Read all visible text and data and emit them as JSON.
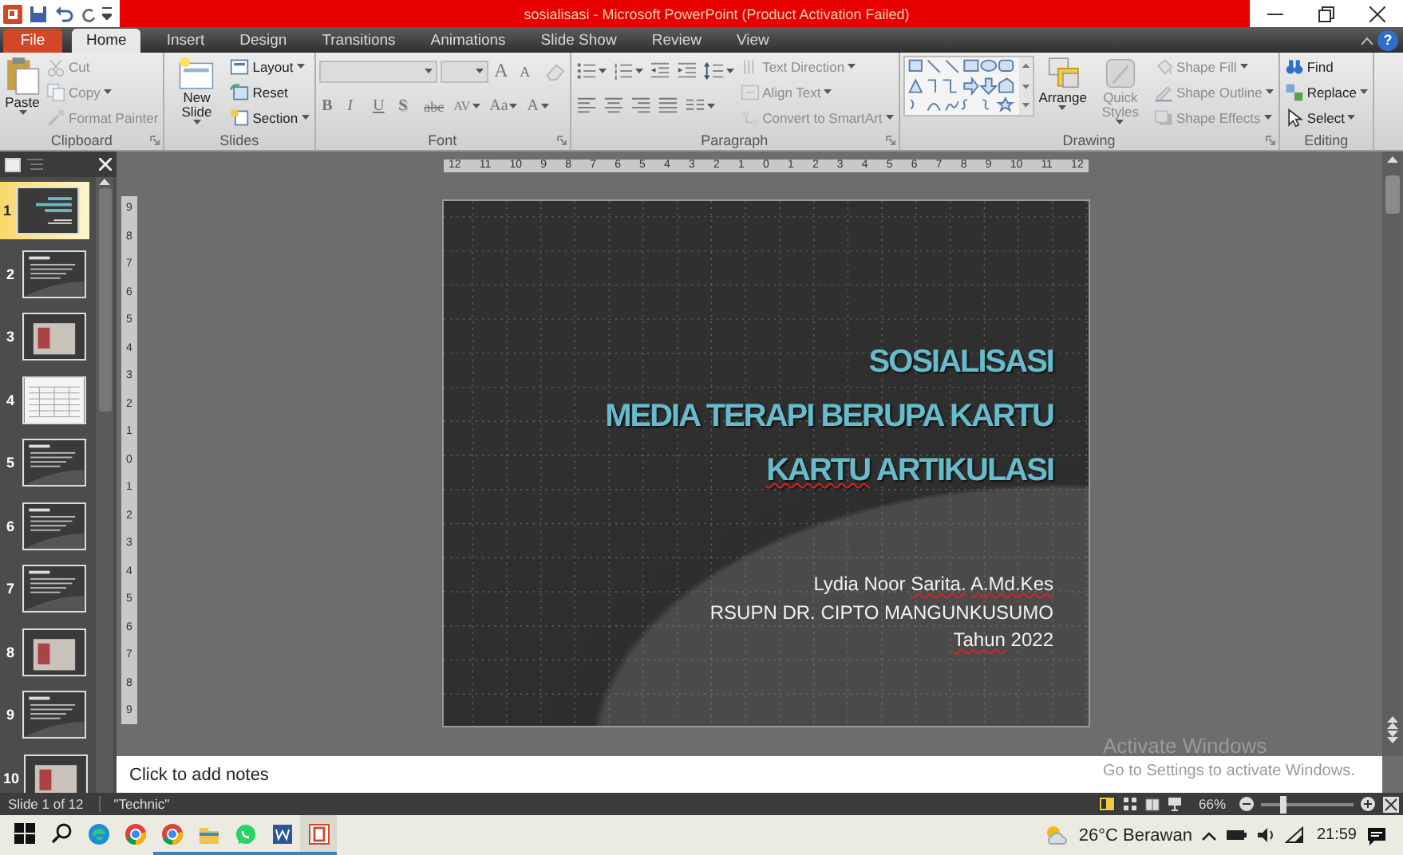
{
  "title_bar": {
    "title": "sosialisasi  -  Microsoft PowerPoint (Product Activation Failed)"
  },
  "ribbon_tabs": [
    {
      "label": "File",
      "kind": "file",
      "selected": false
    },
    {
      "label": "Home",
      "kind": "tab",
      "selected": true
    },
    {
      "label": "Insert",
      "kind": "tab",
      "selected": false
    },
    {
      "label": "Design",
      "kind": "tab",
      "selected": false
    },
    {
      "label": "Transitions",
      "kind": "tab",
      "selected": false
    },
    {
      "label": "Animations",
      "kind": "tab",
      "selected": false
    },
    {
      "label": "Slide Show",
      "kind": "tab",
      "selected": false
    },
    {
      "label": "Review",
      "kind": "tab",
      "selected": false
    },
    {
      "label": "View",
      "kind": "tab",
      "selected": false
    }
  ],
  "help_button": {
    "label": "?"
  },
  "ribbon_groups": [
    {
      "label": "Clipboard",
      "launcher": true,
      "columns": [
        {
          "kind": "large",
          "items": [
            {
              "label": "Paste",
              "dropdown": true,
              "disabled": false
            }
          ]
        },
        {
          "kind": "stack",
          "items": [
            {
              "label": "Cut",
              "dropdown": false,
              "disabled": true
            },
            {
              "label": "Copy",
              "dropdown": true,
              "disabled": true
            },
            {
              "label": "Format Painter",
              "dropdown": false,
              "disabled": true
            }
          ]
        }
      ]
    },
    {
      "label": "Slides",
      "launcher": false,
      "columns": [
        {
          "kind": "large",
          "items": [
            {
              "label": "New Slide",
              "dropdown": true,
              "disabled": false
            }
          ]
        },
        {
          "kind": "stack",
          "items": [
            {
              "label": "Layout",
              "dropdown": true,
              "disabled": false
            },
            {
              "label": "Reset",
              "dropdown": false,
              "disabled": false
            },
            {
              "label": "Section",
              "dropdown": true,
              "disabled": false
            }
          ]
        }
      ]
    },
    {
      "label": "Font",
      "launcher": true,
      "columns": [
        {
          "kind": "rows",
          "rows": [
            {
              "items": [
                {
                  "kind": "field",
                  "disabled": true
                },
                {
                  "kind": "field",
                  "disabled": true
                },
                {
                  "kind": "glyph",
                  "label": "A",
                  "dropdown": false,
                  "disabled": true
                },
                {
                  "kind": "glyph",
                  "label": "A",
                  "dropdown": false,
                  "disabled": true
                },
                {
                  "kind": "icon",
                  "dropdown": false,
                  "disabled": true
                }
              ]
            },
            {
              "items": [
                {
                  "kind": "glyph",
                  "label": "B",
                  "dropdown": false,
                  "disabled": true
                },
                {
                  "kind": "glyph",
                  "label": "I",
                  "dropdown": false,
                  "disabled": true
                },
                {
                  "kind": "glyph",
                  "label": "U",
                  "dropdown": false,
                  "disabled": true
                },
                {
                  "kind": "glyph",
                  "label": "S",
                  "dropdown": false,
                  "disabled": true
                },
                {
                  "kind": "glyph",
                  "label": "abc",
                  "dropdown": false,
                  "disabled": true
                },
                {
                  "kind": "glyph",
                  "label": "AV",
                  "dropdown": true,
                  "disabled": true
                },
                {
                  "kind": "glyph",
                  "label": "Aa",
                  "dropdown": true,
                  "disabled": true
                },
                {
                  "kind": "glyph",
                  "label": "A",
                  "dropdown": true,
                  "disabled": true
                }
              ]
            }
          ]
        }
      ]
    },
    {
      "label": "Paragraph",
      "launcher": true,
      "columns": [
        {
          "kind": "rows",
          "rows": [
            {
              "items": [
                {
                  "kind": "icon",
                  "dropdown": true,
                  "disabled": false
                },
                {
                  "kind": "icon",
                  "dropdown": true,
                  "disabled": false
                },
                {
                  "kind": "icon",
                  "dropdown": false,
                  "disabled": false
                },
                {
                  "kind": "icon",
                  "dropdown": false,
                  "disabled": false
                },
                {
                  "kind": "icon",
                  "dropdown": true,
                  "disabled": false
                }
              ]
            },
            {
              "items": [
                {
                  "kind": "icon",
                  "dropdown": false,
                  "disabled": false
                },
                {
                  "kind": "icon",
                  "dropdown": false,
                  "disabled": false
                },
                {
                  "kind": "icon",
                  "dropdown": false,
                  "disabled": false
                },
                {
                  "kind": "icon",
                  "dropdown": false,
                  "disabled": false
                },
                {
                  "kind": "icon",
                  "dropdown": true,
                  "disabled": false
                }
              ]
            }
          ]
        },
        {
          "kind": "stack",
          "items": [
            {
              "label": "Text Direction",
              "dropdown": true,
              "disabled": true
            },
            {
              "label": "Align Text",
              "dropdown": true,
              "disabled": true
            },
            {
              "label": "Convert to SmartArt",
              "dropdown": true,
              "disabled": true
            }
          ]
        }
      ]
    },
    {
      "label": "Drawing",
      "launcher": true,
      "columns": [
        {
          "kind": "gallery"
        },
        {
          "kind": "large",
          "items": [
            {
              "label": "Arrange",
              "dropdown": true,
              "disabled": false
            }
          ]
        },
        {
          "kind": "large",
          "items": [
            {
              "label": "Quick Styles",
              "dropdown": true,
              "disabled": true
            }
          ]
        },
        {
          "kind": "stack",
          "items": [
            {
              "label": "Shape Fill",
              "dropdown": true,
              "disabled": true
            },
            {
              "label": "Shape Outline",
              "dropdown": true,
              "disabled": true
            },
            {
              "label": "Shape Effects",
              "dropdown": true,
              "disabled": true
            }
          ]
        }
      ]
    },
    {
      "label": "Editing",
      "launcher": false,
      "columns": [
        {
          "kind": "stack",
          "items": [
            {
              "label": "Find",
              "dropdown": false,
              "disabled": false
            },
            {
              "label": "Replace",
              "dropdown": true,
              "disabled": false
            },
            {
              "label": "Select",
              "dropdown": true,
              "disabled": false
            }
          ]
        }
      ]
    }
  ],
  "slide_panel": {
    "thumbnails": [
      {
        "number": "1",
        "kind": "title",
        "selected": true
      },
      {
        "number": "2",
        "kind": "text",
        "selected": false
      },
      {
        "number": "3",
        "kind": "photo",
        "selected": false
      },
      {
        "number": "4",
        "kind": "table",
        "selected": false
      },
      {
        "number": "5",
        "kind": "text",
        "selected": false
      },
      {
        "number": "6",
        "kind": "text",
        "selected": false
      },
      {
        "number": "7",
        "kind": "text",
        "selected": false
      },
      {
        "number": "8",
        "kind": "photo",
        "selected": false
      },
      {
        "number": "9",
        "kind": "text",
        "selected": false
      },
      {
        "number": "10",
        "kind": "photo",
        "selected": false
      }
    ]
  },
  "horizontal_ruler": {
    "labels": [
      "12",
      "11",
      "10",
      "9",
      "8",
      "7",
      "6",
      "5",
      "4",
      "3",
      "2",
      "1",
      "0",
      "1",
      "2",
      "3",
      "4",
      "5",
      "6",
      "7",
      "8",
      "9",
      "10",
      "11",
      "12"
    ]
  },
  "vertical_ruler": {
    "labels": [
      "9",
      "8",
      "7",
      "6",
      "5",
      "4",
      "3",
      "2",
      "1",
      "0",
      "1",
      "2",
      "3",
      "4",
      "5",
      "6",
      "7",
      "8",
      "9"
    ]
  },
  "slide": {
    "title_lines": [
      [
        {
          "text": "SOSIALISASI",
          "misspelled": false
        }
      ],
      [
        {
          "text": "MEDIA TERAPI BERUPA KARTU",
          "misspelled": false
        }
      ],
      [
        {
          "text": "KARTU",
          "misspelled": true
        },
        {
          "text": " ARTIKULASI",
          "misspelled": false
        }
      ]
    ],
    "subtitle_lines": [
      [
        {
          "text": "Lydia Noor ",
          "misspelled": false
        },
        {
          "text": "Sarita.",
          "misspelled": true
        },
        {
          "text": " A.Md.Kes",
          "misspelled": true
        }
      ],
      [
        {
          "text": "RSUPN DR. CIPTO MANGUNKUSUMO",
          "misspelled": false
        }
      ],
      [
        {
          "text": "Tahun",
          "misspelled": true
        },
        {
          "text": " 2022",
          "misspelled": false
        }
      ]
    ]
  },
  "notes": {
    "placeholder": "Click to add notes"
  },
  "activation_notice": {
    "title": "Activate Windows",
    "text": "Go to Settings to activate Windows."
  },
  "status_bar": {
    "slide_info": "Slide 1 of 12",
    "theme": "\"Technic\"",
    "zoom": "66%",
    "zoom_slider": {
      "level": 0.2
    }
  },
  "taskbar": {
    "apps": [
      {
        "running": false,
        "active": false
      },
      {
        "running": false,
        "active": false
      },
      {
        "running": true,
        "active": false
      },
      {
        "running": true,
        "active": false
      },
      {
        "running": true,
        "active": false
      },
      {
        "running": true,
        "active": false
      },
      {
        "running": true,
        "active": true
      }
    ],
    "weather": "26°C  Berawan",
    "time": "21:59"
  }
}
